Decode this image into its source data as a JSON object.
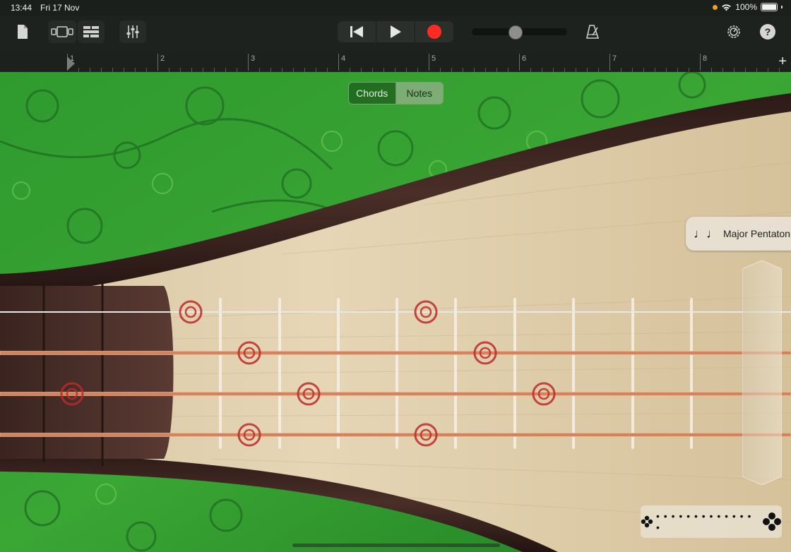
{
  "status_bar": {
    "time": "13:44",
    "date": "Fri 17 Nov",
    "battery": "100%"
  },
  "toolbar": {
    "my_songs": "document-icon",
    "view_toggle": "view-icon",
    "tracks": "tracks-icon",
    "mixer": "mixer-icon",
    "rewind": "rewind-icon",
    "play": "play-icon",
    "record": "record-icon",
    "master_volume": 0.45,
    "metronome": "metronome-icon",
    "settings": "settings-gear-icon",
    "help": "?"
  },
  "ruler": {
    "bars": [
      "1",
      "2",
      "3",
      "4",
      "5",
      "6",
      "7",
      "8"
    ],
    "add": "+"
  },
  "instrument": {
    "mode_control": {
      "chords_label": "Chords",
      "notes_label": "Notes",
      "selected": "Notes"
    },
    "scale_button": {
      "label": "Major Pentatonic",
      "icon": "♩♩"
    },
    "strings": 4,
    "accent_color": "#bc2a2a",
    "fret_positions_marked": [
      [
        1,
        5
      ],
      [
        2,
        6
      ],
      [
        0,
        4,
        8
      ],
      [
        2,
        5
      ]
    ]
  }
}
